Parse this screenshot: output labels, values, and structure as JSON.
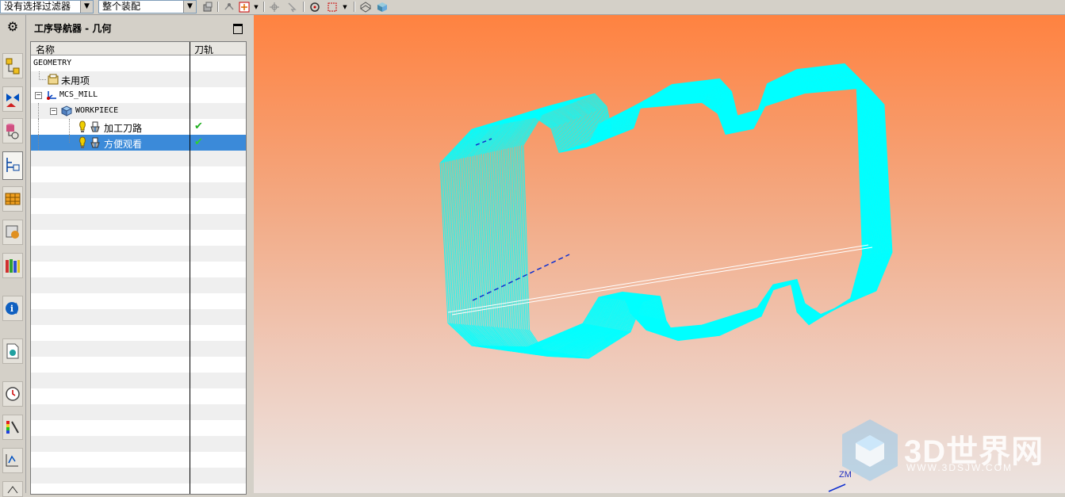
{
  "toolbar": {
    "filter_value": "没有选择过滤器",
    "scope_value": "整个装配"
  },
  "navigator": {
    "title": "工序导航器 - 几何",
    "columns": {
      "name": "名称",
      "toolpath": "刀轨"
    },
    "rows": [
      {
        "label": "GEOMETRY"
      },
      {
        "label": "未用项"
      },
      {
        "label": "MCS_MILL"
      },
      {
        "label": "WORKPIECE"
      },
      {
        "label": "加工刀路",
        "status": "✔"
      },
      {
        "label": "方便观看",
        "status": "✔"
      }
    ]
  },
  "viewport": {
    "watermark": "3D世界网",
    "watermark_url": "WWW.3DSJW.COM",
    "axis_label": "ZM",
    "toolpath_color": "#00ffff"
  },
  "colors": {
    "selection": "#3b8ad9",
    "check": "#20b020"
  }
}
